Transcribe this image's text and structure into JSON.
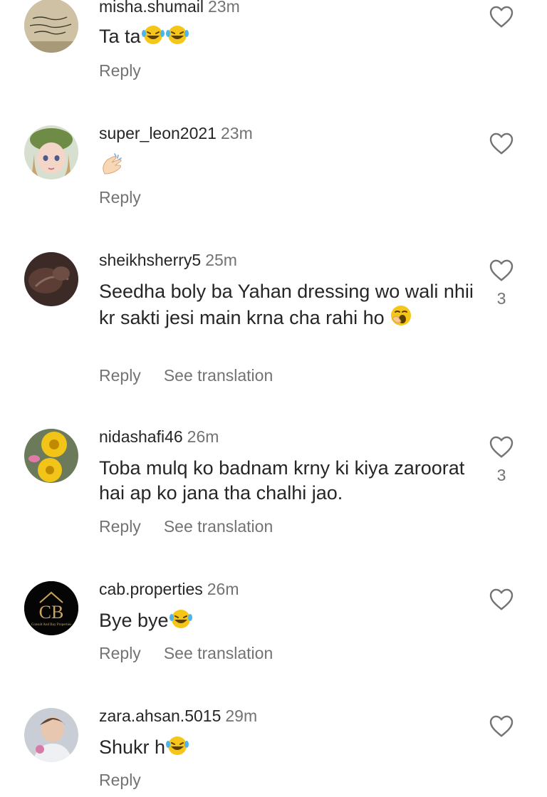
{
  "comments": [
    {
      "username": "misha.shumail",
      "time": "23m",
      "text": "Ta ta",
      "emojis": [
        "laugh-cry-emoji",
        "laugh-cry-emoji"
      ],
      "actions": {
        "reply": "Reply"
      },
      "likes": null
    },
    {
      "username": "super_leon2021",
      "time": "23m",
      "text": "",
      "emojis": [
        "clapping-hands-emoji"
      ],
      "actions": {
        "reply": "Reply"
      },
      "likes": null
    },
    {
      "username": "sheikhsherry5",
      "time": "25m",
      "text": "Seedha boly ba Yahan dressing wo wali nhii kr sakti jesi main krna cha rahi ho",
      "emojis": [
        "yawning-face-emoji"
      ],
      "actions": {
        "reply": "Reply",
        "translate": "See translation"
      },
      "likes": "3"
    },
    {
      "username": "nidashafi46",
      "time": "26m",
      "text": "Toba mulq ko badnam krny ki kiya zaroorat  hai ap ko jana tha chalhi jao.",
      "emojis": [],
      "actions": {
        "reply": "Reply",
        "translate": "See translation"
      },
      "likes": "3"
    },
    {
      "username": "cab.properties",
      "time": "26m",
      "text": "Bye bye",
      "emojis": [
        "laugh-cry-emoji"
      ],
      "actions": {
        "reply": "Reply",
        "translate": "See translation"
      },
      "likes": null
    },
    {
      "username": "zara.ahsan.5015",
      "time": "29m",
      "text": "Shukr h",
      "emojis": [
        "laugh-cry-emoji"
      ],
      "actions": {
        "reply": "Reply"
      },
      "likes": null
    }
  ],
  "avatar_logo_letters": "CB",
  "avatar_logo_caption": "Consult And Buy Properties"
}
